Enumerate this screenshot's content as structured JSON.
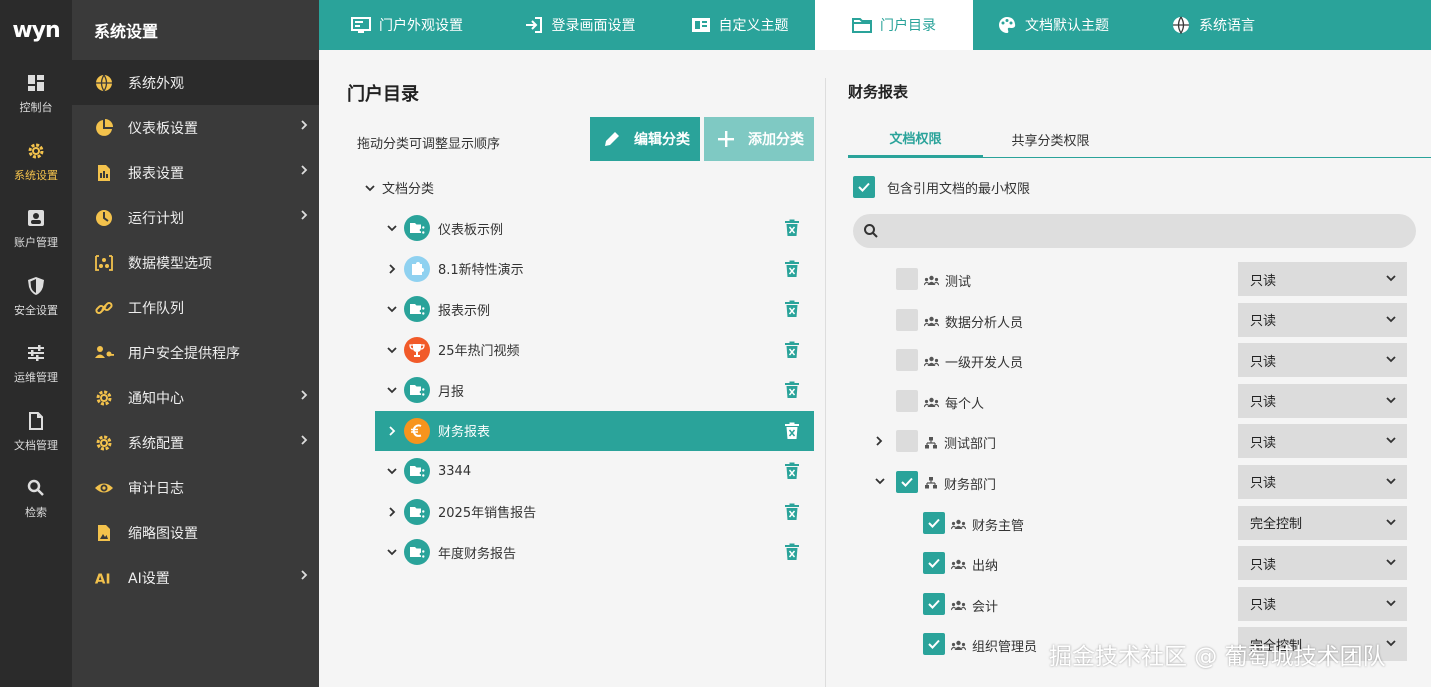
{
  "brand": {
    "logo_text": "wyn"
  },
  "rail": [
    {
      "label": "控制台",
      "icon": "dashboard-icon"
    },
    {
      "label": "系统设置",
      "icon": "gear-icon",
      "active": true
    },
    {
      "label": "账户管理",
      "icon": "account-icon"
    },
    {
      "label": "安全设置",
      "icon": "shield-icon"
    },
    {
      "label": "运维管理",
      "icon": "sliders-icon"
    },
    {
      "label": "文档管理",
      "icon": "document-icon"
    },
    {
      "label": "检索",
      "icon": "search-icon"
    }
  ],
  "sidebar": {
    "title": "系统设置",
    "items": [
      {
        "label": "系统外观",
        "icon": "globe-icon",
        "active": true,
        "has_children": false
      },
      {
        "label": "仪表板设置",
        "icon": "pie-icon",
        "has_children": true
      },
      {
        "label": "报表设置",
        "icon": "report-icon",
        "has_children": true
      },
      {
        "label": "运行计划",
        "icon": "clock-icon",
        "has_children": true
      },
      {
        "label": "数据模型选项",
        "icon": "model-icon",
        "has_children": false
      },
      {
        "label": "工作队列",
        "icon": "link-icon",
        "has_children": false
      },
      {
        "label": "用户安全提供程序",
        "icon": "user-key-icon",
        "has_children": false
      },
      {
        "label": "通知中心",
        "icon": "gear-icon",
        "has_children": true
      },
      {
        "label": "系统配置",
        "icon": "gear-icon",
        "has_children": true
      },
      {
        "label": "审计日志",
        "icon": "eye-icon",
        "has_children": false
      },
      {
        "label": "缩略图设置",
        "icon": "image-icon",
        "has_children": false
      },
      {
        "label": "AI设置",
        "icon": "ai-icon",
        "has_children": true
      }
    ]
  },
  "tabs": [
    {
      "label": "门户外观设置",
      "icon": "monitor-icon"
    },
    {
      "label": "登录画面设置",
      "icon": "login-icon"
    },
    {
      "label": "自定义主题",
      "icon": "theme-icon"
    },
    {
      "label": "门户目录",
      "icon": "folder-icon",
      "active": true
    },
    {
      "label": "文档默认主题",
      "icon": "palette-icon"
    },
    {
      "label": "系统语言",
      "icon": "globe-icon"
    }
  ],
  "catalog": {
    "title": "门户目录",
    "hint": "拖动分类可调整显示顺序",
    "edit_label": "编辑分类",
    "add_label": "添加分类",
    "root_label": "文档分类",
    "items": [
      {
        "label": "仪表板示例",
        "expanded": true,
        "color": "#2aa39a",
        "icon": "folder-share-icon"
      },
      {
        "label": "8.1新特性演示",
        "expanded": false,
        "color": "#8fd1f0",
        "icon": "puzzle-icon"
      },
      {
        "label": "报表示例",
        "expanded": true,
        "color": "#2aa39a",
        "icon": "folder-share-icon"
      },
      {
        "label": "25年热门视频",
        "expanded": true,
        "color": "#f15a29",
        "icon": "trophy-icon"
      },
      {
        "label": "月报",
        "expanded": true,
        "color": "#2aa39a",
        "icon": "folder-share-icon"
      },
      {
        "label": "财务报表",
        "expanded": false,
        "color": "#f7941d",
        "icon": "euro-icon",
        "selected": true
      },
      {
        "label": "3344",
        "expanded": true,
        "color": "#2aa39a",
        "icon": "folder-share-icon"
      },
      {
        "label": "2025年销售报告",
        "expanded": false,
        "color": "#2aa39a",
        "icon": "folder-share-icon"
      },
      {
        "label": "年度财务报告",
        "expanded": true,
        "color": "#2aa39a",
        "icon": "folder-share-icon"
      }
    ]
  },
  "permissions": {
    "title": "财务报表",
    "tab_doc": "文档权限",
    "tab_share": "共享分类权限",
    "include_label": "包含引用文档的最小权限",
    "include_checked": true,
    "search_placeholder": "",
    "rows": [
      {
        "label": "测试",
        "checked": false,
        "level": 0,
        "type": "role",
        "arrow": "",
        "value": "只读"
      },
      {
        "label": "数据分析人员",
        "checked": false,
        "level": 0,
        "type": "role",
        "arrow": "",
        "value": "只读"
      },
      {
        "label": "一级开发人员",
        "checked": false,
        "level": 0,
        "type": "role",
        "arrow": "",
        "value": "只读"
      },
      {
        "label": "每个人",
        "checked": false,
        "level": 0,
        "type": "role",
        "arrow": "",
        "value": "只读"
      },
      {
        "label": "测试部门",
        "checked": false,
        "level": 0,
        "type": "org",
        "arrow": "right",
        "value": "只读"
      },
      {
        "label": "财务部门",
        "checked": true,
        "level": 0,
        "type": "org",
        "arrow": "down",
        "value": "只读"
      },
      {
        "label": "财务主管",
        "checked": true,
        "level": 1,
        "type": "role",
        "arrow": "",
        "value": "完全控制"
      },
      {
        "label": "出纳",
        "checked": true,
        "level": 1,
        "type": "role",
        "arrow": "",
        "value": "只读"
      },
      {
        "label": "会计",
        "checked": true,
        "level": 1,
        "type": "role",
        "arrow": "",
        "value": "只读"
      },
      {
        "label": "组织管理员",
        "checked": true,
        "level": 1,
        "type": "role",
        "arrow": "",
        "value": "完全控制"
      }
    ]
  },
  "watermark": "掘金技术社区 @ 葡萄城技术团队",
  "colors": {
    "accent": "#2aa39a",
    "accent_light": "#7fc9c3",
    "rail_bg": "#2b2b2b",
    "sidebar_bg": "#3a3a3a",
    "active_rail": "#f3c24c"
  }
}
